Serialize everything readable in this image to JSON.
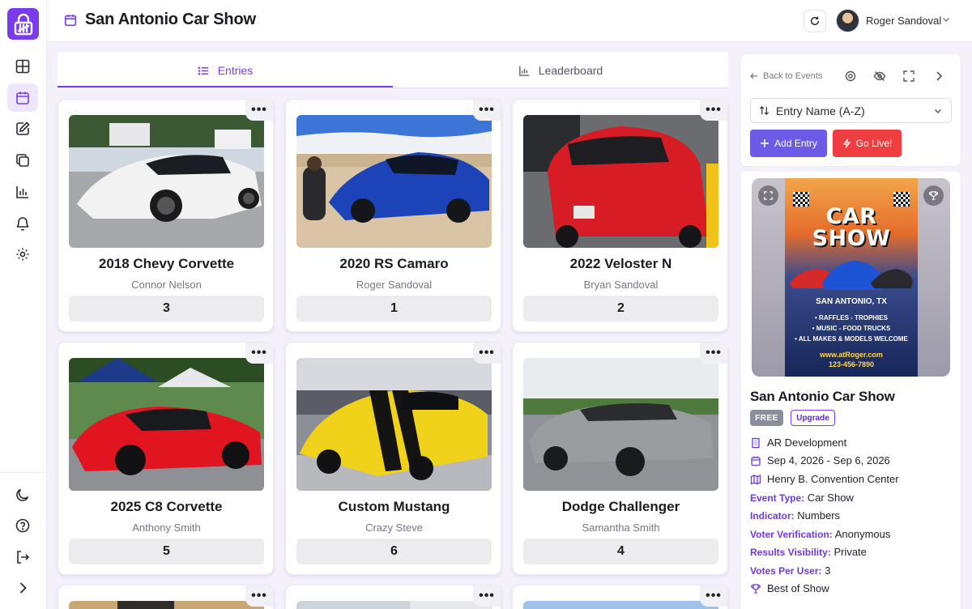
{
  "app": {
    "logo": "app-lock-logo"
  },
  "header": {
    "title": "San Antonio Car Show",
    "user_name": "Roger Sandoval"
  },
  "sidebar": {
    "items": [
      {
        "icon": "dashboard-grid-icon"
      },
      {
        "icon": "calendar-icon",
        "active": true
      },
      {
        "icon": "edit-icon"
      },
      {
        "icon": "copy-icon"
      },
      {
        "icon": "bar-chart-icon"
      },
      {
        "icon": "bell-icon"
      },
      {
        "icon": "gear-icon"
      }
    ],
    "bottom": [
      {
        "icon": "moon-icon"
      },
      {
        "icon": "help-icon"
      },
      {
        "icon": "logout-icon"
      },
      {
        "icon": "chevron-right-icon"
      }
    ]
  },
  "tabs": [
    {
      "label": "Entries",
      "active": true
    },
    {
      "label": "Leaderboard",
      "active": false
    }
  ],
  "entries": [
    {
      "title": "2018 Chevy Corvette",
      "owner": "Connor Nelson",
      "rank": "3",
      "color": "#f2f2f2"
    },
    {
      "title": "2020 RS Camaro",
      "owner": "Roger Sandoval",
      "rank": "1",
      "color": "#1c44b8"
    },
    {
      "title": "2022 Veloster N",
      "owner": "Bryan Sandoval",
      "rank": "2",
      "color": "#d81c26"
    },
    {
      "title": "2025 C8 Corvette",
      "owner": "Anthony Smith",
      "rank": "5",
      "color": "#e0151f"
    },
    {
      "title": "Custom Mustang",
      "owner": "Crazy Steve",
      "rank": "6",
      "color": "#f1d21a"
    },
    {
      "title": "Dodge Challenger",
      "owner": "Samantha Smith",
      "rank": "4",
      "color": "#9a9ca0"
    }
  ],
  "menu_label": "•••",
  "right_panel": {
    "back_label": "Back to Events",
    "sort_label": "Entry Name (A-Z)",
    "add_entry_label": "Add Entry",
    "go_live_label": "Go Live!"
  },
  "event": {
    "title": "San Antonio Car Show",
    "badge_free": "FREE",
    "badge_upgrade": "Upgrade",
    "organizer": "AR Development",
    "dates": "Sep 4, 2026 - Sep 6, 2026",
    "venue": "Henry B. Convention Center",
    "details": [
      {
        "key": "Event Type:",
        "value": "Car Show"
      },
      {
        "key": "Indicator:",
        "value": "Numbers"
      },
      {
        "key": "Voter Verification:",
        "value": "Anonymous"
      },
      {
        "key": "Results Visibility:",
        "value": "Private"
      },
      {
        "key": "Votes Per User:",
        "value": "3"
      }
    ],
    "award": "Best of Show",
    "poster": {
      "title_line1": "CAR",
      "title_line2": "SHOW",
      "location": "SAN ANTONIO, TX",
      "bullets": [
        "• RAFFLES - TROPHIES",
        "• MUSIC - FOOD TRUCKS",
        "• ALL MAKES & MODELS WELCOME"
      ],
      "website": "www.atRoger.com",
      "phone": "123-456-7890"
    }
  },
  "colors": {
    "accent": "#7c3aed",
    "live": "#ef3e42",
    "add": "#6d5ae6"
  }
}
